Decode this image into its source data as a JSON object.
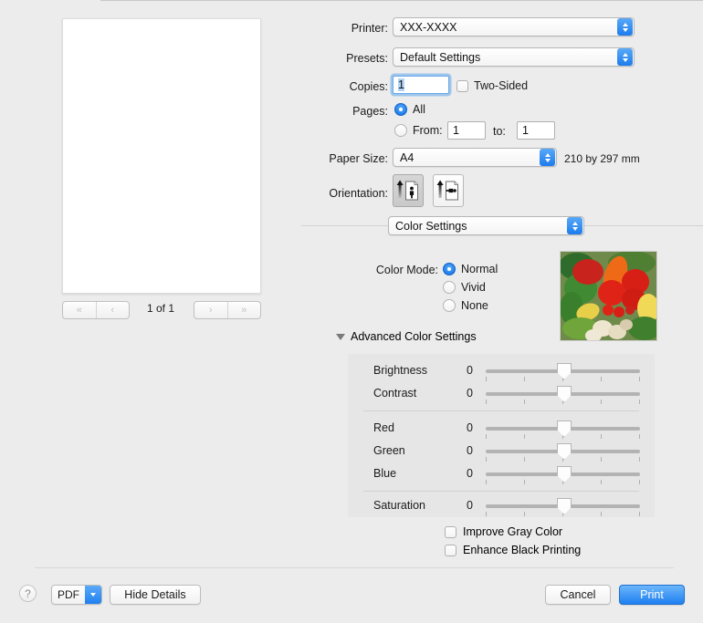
{
  "preview": {
    "page_counter": "1 of 1",
    "nav_first": "«",
    "nav_prev": "‹",
    "nav_next": "›",
    "nav_last": "»"
  },
  "settings": {
    "printer_label": "Printer:",
    "printer_value": "XXX-XXXX",
    "presets_label": "Presets:",
    "presets_value": "Default Settings",
    "copies_label": "Copies:",
    "copies_value": "1",
    "two_sided_label": "Two-Sided",
    "pages_label": "Pages:",
    "pages_all_label": "All",
    "pages_from_label": "From:",
    "pages_from_value": "1",
    "pages_to_label": "to:",
    "pages_to_value": "1",
    "paper_size_label": "Paper Size:",
    "paper_size_value": "A4",
    "paper_dimensions": "210 by 297 mm",
    "orientation_label": "Orientation:",
    "section_value": "Color Settings"
  },
  "color": {
    "color_mode_label": "Color Mode:",
    "modes": [
      {
        "label": "Normal",
        "selected": true
      },
      {
        "label": "Vivid",
        "selected": false
      },
      {
        "label": "None",
        "selected": false
      }
    ],
    "advanced_label": "Advanced Color Settings",
    "sliders": [
      {
        "name": "Brightness",
        "value": "0"
      },
      {
        "name": "Contrast",
        "value": "0"
      },
      {
        "name": "Red",
        "value": "0"
      },
      {
        "name": "Green",
        "value": "0"
      },
      {
        "name": "Blue",
        "value": "0"
      },
      {
        "name": "Saturation",
        "value": "0"
      }
    ],
    "improve_gray_label": "Improve Gray Color",
    "enhance_black_label": "Enhance Black Printing"
  },
  "bottom": {
    "help_label": "?",
    "pdf_label": "PDF",
    "hide_details_label": "Hide Details",
    "cancel_label": "Cancel",
    "print_label": "Print"
  },
  "colors": {
    "accent_blue": "#1f7ff0",
    "panel_bg": "#e6e6e6",
    "window_bg": "#ececec"
  }
}
